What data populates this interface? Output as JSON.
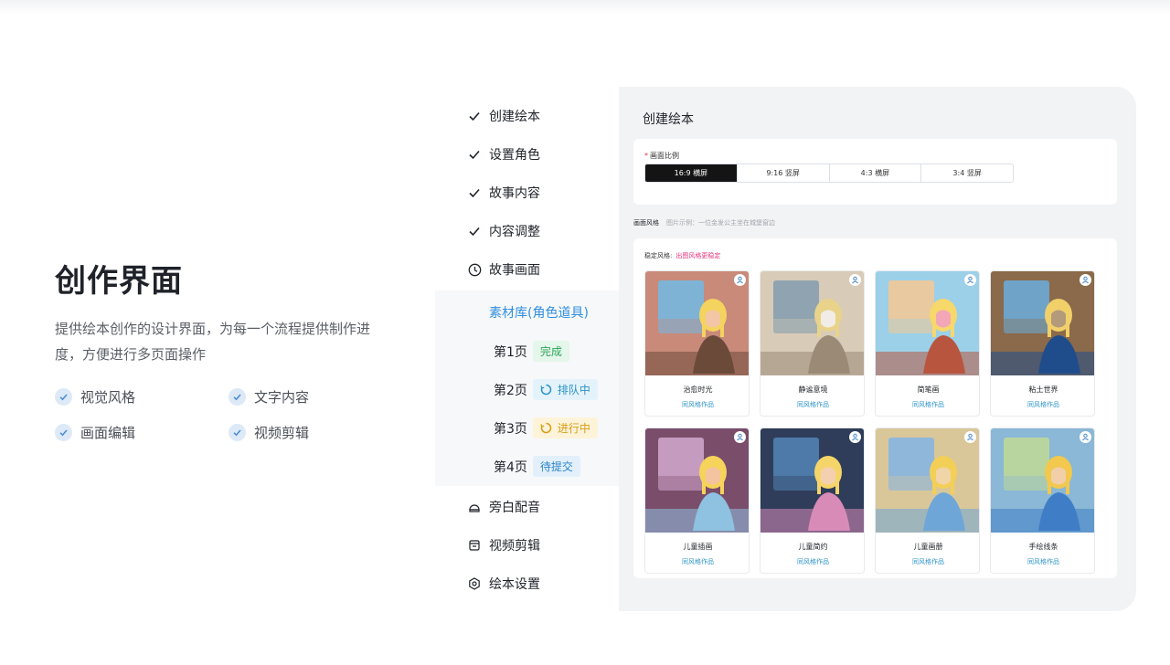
{
  "hero": {
    "title": "创作界面",
    "description": "提供绘本创作的设计界面，为每一个流程提供制作进度，方便进行多页面操作",
    "features": [
      "视觉风格",
      "文字内容",
      "画面编辑",
      "视频剪辑"
    ]
  },
  "sidebar": {
    "steps": [
      {
        "label": "创建绘本",
        "icon": "check-icon"
      },
      {
        "label": "设置角色",
        "icon": "check-icon"
      },
      {
        "label": "故事内容",
        "icon": "check-icon"
      },
      {
        "label": "内容调整",
        "icon": "check-icon"
      },
      {
        "label": "故事画面",
        "icon": "clock-icon"
      }
    ],
    "library_label": "素材库(角色道具)",
    "pages": [
      {
        "label": "第1页",
        "status": "完成"
      },
      {
        "label": "第2页",
        "status": "排队中"
      },
      {
        "label": "第3页",
        "status": "进行中"
      },
      {
        "label": "第4页",
        "status": "待提交"
      }
    ],
    "bottom_steps": [
      {
        "label": "旁白配音",
        "icon": "voice-icon"
      },
      {
        "label": "视频剪辑",
        "icon": "video-edit-icon"
      },
      {
        "label": "绘本设置",
        "icon": "gear-icon"
      }
    ]
  },
  "main": {
    "title": "创建绘本",
    "ratio_label": "画面比例",
    "ratios": [
      "16:9 横屏",
      "9:16 竖屏",
      "4:3 横屏",
      "3:4 竖屏"
    ],
    "selected_ratio": "16:9 横屏",
    "style_label": "画面风格",
    "style_hint": "图片示例：一位金发公主坐在城堡窗边",
    "locked_label": "稳定风格:",
    "locked_value": "出图风格更稳定",
    "styles": [
      {
        "name": "治愈时光",
        "sub": "同风格作品"
      },
      {
        "name": "静谧意境",
        "sub": "同风格作品"
      },
      {
        "name": "简笔画",
        "sub": "同风格作品"
      },
      {
        "name": "粘土世界",
        "sub": "同风格作品"
      },
      {
        "name": "儿童插画",
        "sub": "同风格作品"
      },
      {
        "name": "儿童简约",
        "sub": "同风格作品"
      },
      {
        "name": "儿童画册",
        "sub": "同风格作品"
      },
      {
        "name": "手绘线条",
        "sub": "同风格作品"
      }
    ]
  },
  "colors": {
    "accent_blue": "#2f8fde",
    "selected_black": "#141414",
    "status_done": "#2ea55a",
    "status_running": "#d89c12",
    "highlight_pink": "#e5307a"
  }
}
